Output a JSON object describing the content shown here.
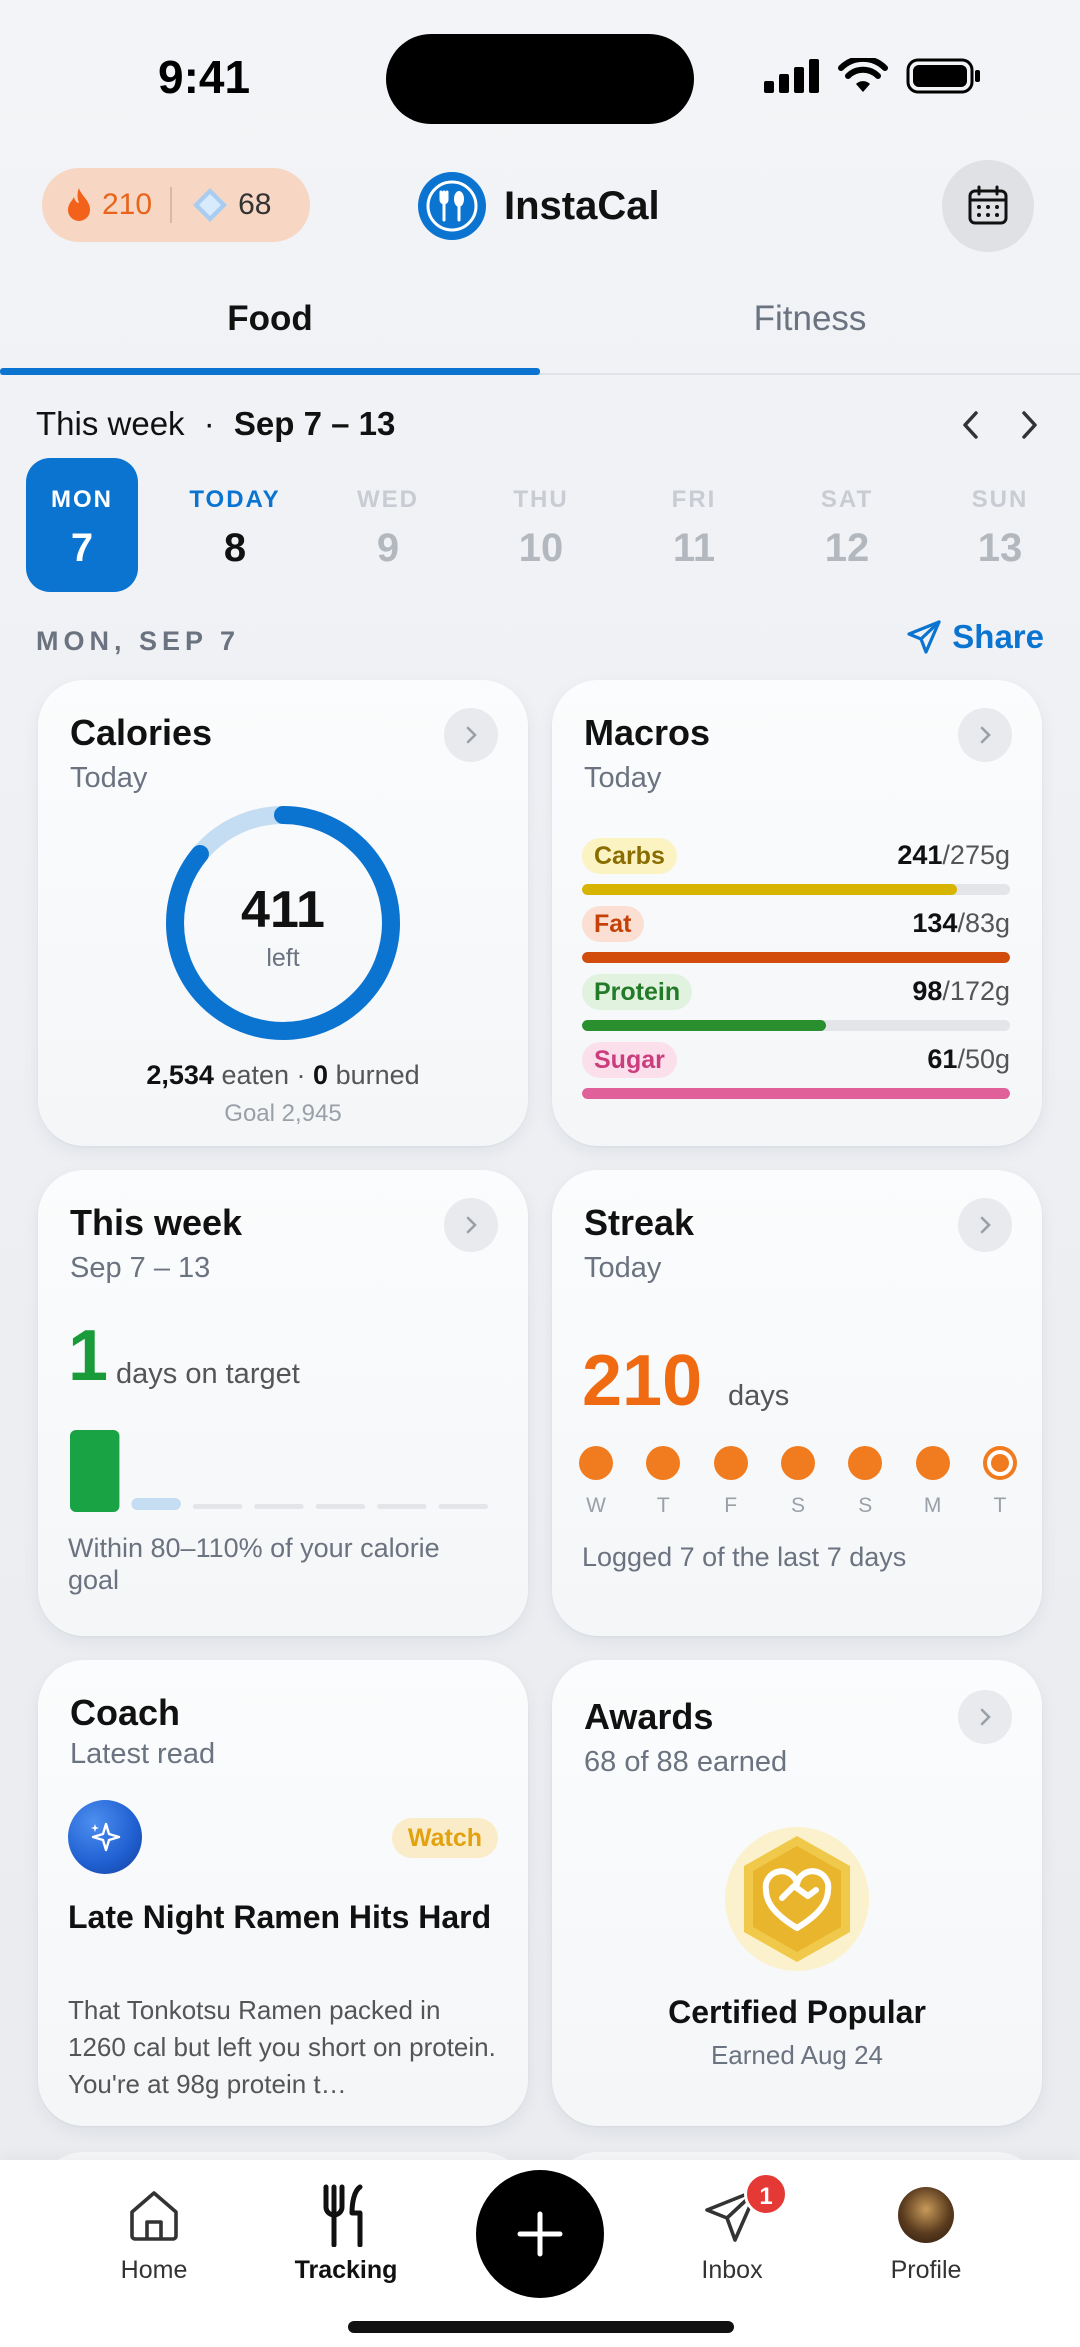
{
  "status": {
    "time": "9:41"
  },
  "header": {
    "streak_count": "210",
    "gem_count": "68",
    "app_name": "InstaCal"
  },
  "tabs": [
    {
      "label": "Food",
      "active": true
    },
    {
      "label": "Fitness",
      "active": false
    }
  ],
  "week": {
    "label": "This week",
    "separator": "·",
    "range": "Sep 7 – 13",
    "days": [
      {
        "name": "MON",
        "num": "7"
      },
      {
        "name": "TODAY",
        "num": "8"
      },
      {
        "name": "WED",
        "num": "9"
      },
      {
        "name": "THU",
        "num": "10"
      },
      {
        "name": "FRI",
        "num": "11"
      },
      {
        "name": "SAT",
        "num": "12"
      },
      {
        "name": "SUN",
        "num": "13"
      }
    ]
  },
  "selected_date_label": "MON, SEP 7",
  "share_label": "Share",
  "calories": {
    "title": "Calories",
    "subtitle": "Today",
    "left_value": "411",
    "left_label": "left",
    "eaten": "2,534",
    "eaten_label": "eaten ·",
    "burned": "0",
    "burned_label": "burned",
    "goal": "Goal 2,945",
    "eaten_fraction": 0.86
  },
  "macros": {
    "title": "Macros",
    "subtitle": "Today",
    "items": [
      {
        "name": "Carbs",
        "value": "241",
        "target": "/275g",
        "fraction": 0.876,
        "color": "#d7b400",
        "tag_bg": "#fbf3c2",
        "tag_fg": "#8a6d00"
      },
      {
        "name": "Fat",
        "value": "134",
        "target": "/83g",
        "fraction": 1.0,
        "color": "#d24c0c",
        "tag_bg": "#fadfd2",
        "tag_fg": "#c44208"
      },
      {
        "name": "Protein",
        "value": "98",
        "target": "/172g",
        "fraction": 0.57,
        "color": "#2a8f2f",
        "tag_bg": "#e1f2df",
        "tag_fg": "#237a28"
      },
      {
        "name": "Sugar",
        "value": "61",
        "target": "/50g",
        "fraction": 1.0,
        "color": "#e0609a",
        "tag_bg": "#fbe0ec",
        "tag_fg": "#cc3d7e"
      }
    ]
  },
  "this_week": {
    "title": "This week",
    "subtitle": "Sep 7 – 13",
    "count": "1",
    "count_label": "days on target",
    "note": "Within 80–110% of your calorie goal",
    "day_states": [
      "hit",
      "partial",
      "empty",
      "empty",
      "empty",
      "empty",
      "empty"
    ]
  },
  "streak": {
    "title": "Streak",
    "subtitle": "Today",
    "days": "210",
    "days_label": "days",
    "labels": [
      "W",
      "T",
      "F",
      "S",
      "S",
      "M",
      "T"
    ],
    "note": "Logged 7 of the last 7 days"
  },
  "coach": {
    "title": "Coach",
    "subtitle": "Latest read",
    "tag": "Watch",
    "headline": "Late Night Ramen Hits Hard",
    "body": "That Tonkotsu Ramen packed in 1260 cal but left you short on protein. You're at 98g protein t…"
  },
  "awards": {
    "title": "Awards",
    "subtitle": "68 of 88 earned",
    "award_name": "Certified Popular",
    "award_date": "Earned Aug 24"
  },
  "nav": {
    "home": "Home",
    "tracking": "Tracking",
    "inbox": "Inbox",
    "inbox_badge": "1",
    "profile": "Profile"
  },
  "colors": {
    "accent": "#0b74d1",
    "streak_orange": "#f06a12",
    "target_green": "#1a9b3a"
  }
}
